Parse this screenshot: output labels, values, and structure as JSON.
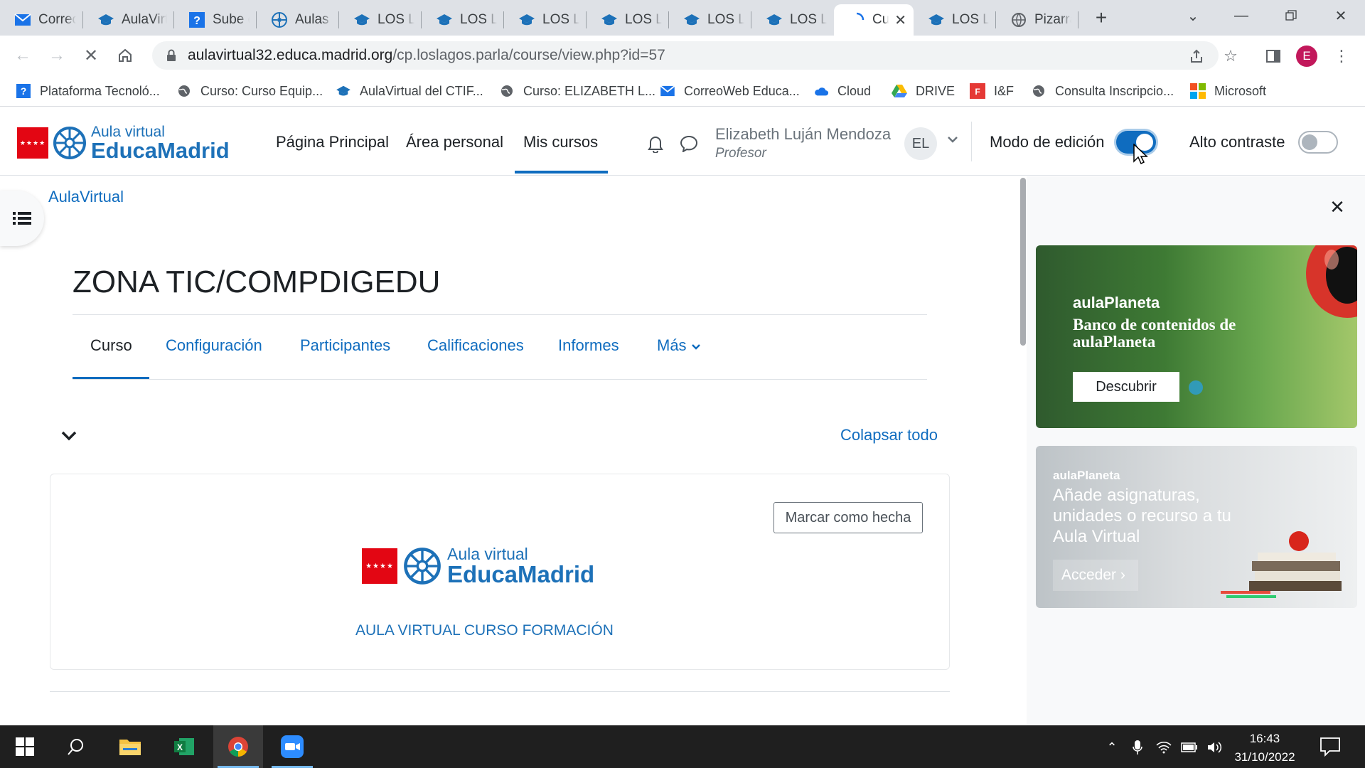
{
  "browser": {
    "tabs": [
      {
        "label": "Correo",
        "icon": "mail-icon"
      },
      {
        "label": "AulaVirtual",
        "icon": "moodle-cap-icon"
      },
      {
        "label": "Sube d",
        "icon": "question-icon"
      },
      {
        "label": "Aulas V",
        "icon": "educamadrid-wheel-icon"
      },
      {
        "label": "LOS LA",
        "icon": "moodle-cap-icon"
      },
      {
        "label": "LOS LA",
        "icon": "moodle-cap-icon"
      },
      {
        "label": "LOS LA",
        "icon": "moodle-cap-icon"
      },
      {
        "label": "LOS LA",
        "icon": "moodle-cap-icon"
      },
      {
        "label": "LOS LA",
        "icon": "moodle-cap-icon"
      },
      {
        "label": "LOS LA",
        "icon": "moodle-cap-icon"
      },
      {
        "label": "Cur",
        "icon": "loading-spinner-icon",
        "active": true
      },
      {
        "label": "LOS LA",
        "icon": "moodle-cap-icon"
      },
      {
        "label": "Pizarra",
        "icon": "globe-icon"
      }
    ],
    "url_host": "aulavirtual32.educa.madrid.org",
    "url_path": "/cp.loslagos.parla/course/view.php?id=57",
    "profile_initial": "E",
    "bookmarks": [
      {
        "label": "Plataforma Tecnoló...",
        "icon": "question-icon"
      },
      {
        "label": "Curso: Curso Equip...",
        "icon": "globe-icon"
      },
      {
        "label": "AulaVirtual del CTIF...",
        "icon": "moodle-cap-icon"
      },
      {
        "label": "Curso: ELIZABETH L...",
        "icon": "globe-icon"
      },
      {
        "label": "CorreoWeb Educa...",
        "icon": "mail-icon"
      },
      {
        "label": "Cloud",
        "icon": "cloud-icon"
      },
      {
        "label": "DRIVE",
        "icon": "drive-icon"
      },
      {
        "label": "I&F",
        "icon": "if-icon"
      },
      {
        "label": "Consulta Inscripcio...",
        "icon": "globe-icon"
      },
      {
        "label": "Microsoft",
        "icon": "microsoft-icon"
      }
    ]
  },
  "site": {
    "logo_line1": "Aula virtual",
    "logo_line2": "EducaMadrid",
    "nav": [
      "Página Principal",
      "Área personal",
      "Mis cursos"
    ],
    "user_name": "Elizabeth Luján Mendoza",
    "user_role": "Profesor",
    "user_initials": "EL",
    "edit_mode_label": "Modo de edición",
    "edit_mode_on": true,
    "high_contrast_label": "Alto contraste",
    "high_contrast_on": false
  },
  "course": {
    "breadcrumb": "AulaVirtual",
    "title": "ZONA TIC/COMPDIGEDU",
    "tabs": [
      "Curso",
      "Configuración",
      "Participantes",
      "Calificaciones",
      "Informes",
      "Más"
    ],
    "collapse_all": "Colapsar todo",
    "mark_done": "Marcar como hecha",
    "card_logo_line1": "Aula virtual",
    "card_logo_line2": "EducaMadrid",
    "card_caption": "AULA VIRTUAL CURSO FORMACIÓN"
  },
  "drawer": {
    "banner1_brand": "aulaPlaneta",
    "banner1_title": "Banco de contenidos de aulaPlaneta",
    "banner1_button": "Descubrir",
    "banner2_brand": "aulaPlaneta",
    "banner2_title": "Añade asignaturas, unidades o recurso a tu Aula Virtual",
    "banner2_button": "Acceder"
  },
  "taskbar": {
    "time": "16:43",
    "date": "31/10/2022"
  },
  "colors": {
    "moodle_blue": "#0f6cbf",
    "educamadrid_blue": "#1d71b8",
    "madrid_red": "#e30613"
  }
}
